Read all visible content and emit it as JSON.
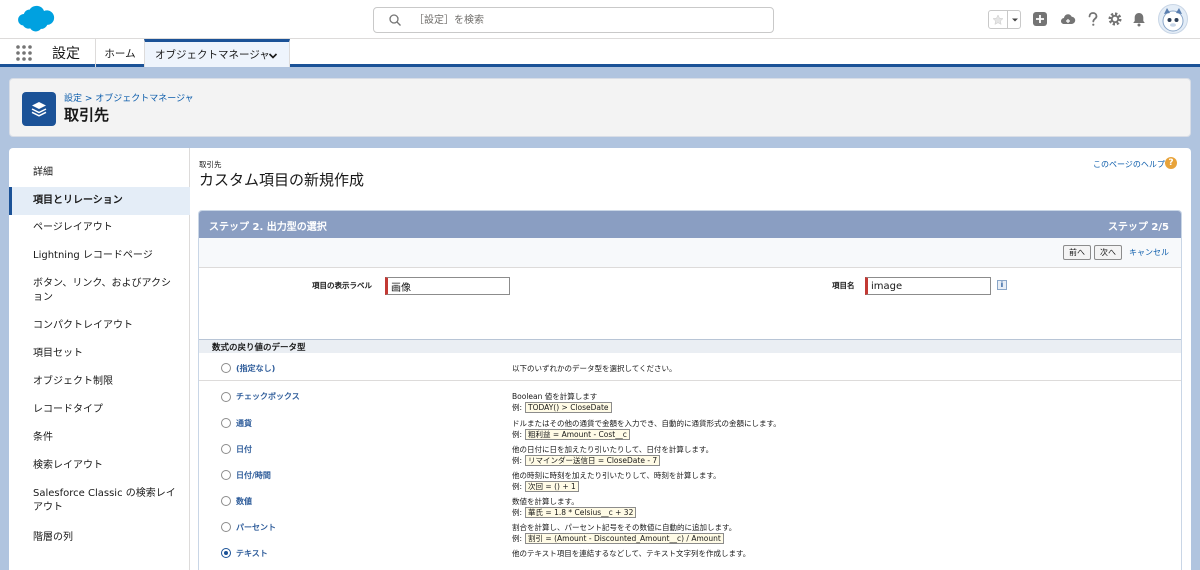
{
  "header": {
    "search_placeholder": "［設定］を検索"
  },
  "context_bar": {
    "app_name": "設定",
    "tabs": [
      {
        "label": "ホーム"
      },
      {
        "label": "オブジェクトマネージャ"
      }
    ]
  },
  "page_header": {
    "breadcrumb": "設定 > オブジェクトマネージャ",
    "title": "取引先"
  },
  "sidebar": {
    "items": [
      {
        "label": "詳細",
        "active": false
      },
      {
        "label": "項目とリレーション",
        "active": true
      },
      {
        "label": "ページレイアウト",
        "active": false
      },
      {
        "label": "Lightning レコードページ",
        "active": false
      },
      {
        "label": "ボタン、リンク、およびアクション",
        "active": false
      },
      {
        "label": "コンパクトレイアウト",
        "active": false
      },
      {
        "label": "項目セット",
        "active": false
      },
      {
        "label": "オブジェクト制限",
        "active": false
      },
      {
        "label": "レコードタイプ",
        "active": false
      },
      {
        "label": "条件",
        "active": false
      },
      {
        "label": "検索レイアウト",
        "active": false
      },
      {
        "label": "Salesforce Classic の検索レイアウト",
        "active": false
      },
      {
        "label": "階層の列",
        "active": false
      }
    ]
  },
  "main": {
    "eyebrow": "取引先",
    "title": "カスタム項目の新規作成",
    "help_link": "このページのヘルプ",
    "step": {
      "title": "ステップ 2. 出力型の選択",
      "count": "ステップ 2/5"
    },
    "buttons": {
      "prev": "前へ",
      "next": "次へ",
      "cancel": "キャンセル"
    },
    "fields": {
      "label_caption": "項目の表示ラベル",
      "label_value": "画像",
      "name_caption": "項目名",
      "name_value": "image"
    },
    "section_title": "数式の戻り値のデータ型",
    "types": [
      {
        "label": "(指定なし)",
        "desc": "以下のいずれかのデータ型を選択してください。",
        "ex_prefix": "",
        "ex": "",
        "checked": false
      },
      {
        "label": "チェックボックス",
        "desc": "Boolean 値を計算します",
        "ex_prefix": "例:",
        "ex": "TODAY() > CloseDate",
        "checked": false
      },
      {
        "label": "通貨",
        "desc": "ドルまたはその他の通貨で金額を入力でき、自動的に通貨形式の金額にします。",
        "ex_prefix": "例:",
        "ex": "粗利益 = Amount - Cost__c",
        "checked": false
      },
      {
        "label": "日付",
        "desc": "他の日付に日を加えたり引いたりして、日付を計算します。",
        "ex_prefix": "例:",
        "ex": "リマインダー送信日 = CloseDate - 7",
        "checked": false
      },
      {
        "label": "日付/時間",
        "desc": "他の時刻に時刻を加えたり引いたりして、時刻を計算します。",
        "ex_prefix": "例:",
        "ex": "次回 = () + 1",
        "checked": false
      },
      {
        "label": "数値",
        "desc": "数値を計算します。",
        "ex_prefix": "例:",
        "ex": "華氏 = 1.8 * Celsius__c + 32",
        "checked": false
      },
      {
        "label": "パーセント",
        "desc": "割合を計算し、パーセント記号をその数値に自動的に追加します。",
        "ex_prefix": "例:",
        "ex": "割引 = (Amount - Discounted_Amount__c) / Amount",
        "checked": false
      },
      {
        "label": "テキスト",
        "desc": "他のテキスト項目を連結するなどして、テキスト文字列を作成します。",
        "ex_prefix": "",
        "ex": "",
        "checked": true
      }
    ]
  },
  "colors": {
    "brand": "#1b5297",
    "link": "#0b5cab",
    "step_bar": "#8a9ec2",
    "required": "#c23934"
  }
}
